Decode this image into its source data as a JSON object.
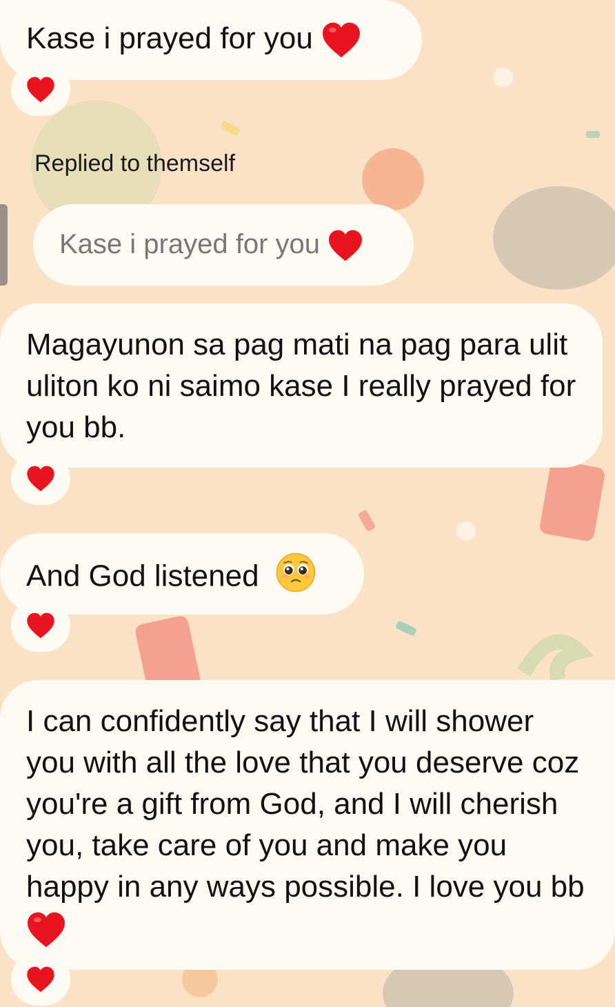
{
  "messages": [
    {
      "text": "Kase i prayed for you",
      "trailing": "heart-icon",
      "reaction": "heart-icon"
    },
    {
      "text": "Magayunon sa pag mati na pag para ulit uliton ko ni saimo kase I really prayed for you bb.",
      "reaction": "heart-icon"
    },
    {
      "text": "And God listened",
      "trailing": "pleading-face-icon",
      "reaction": "heart-icon"
    },
    {
      "text": "I can confidently say that I will shower you with all the love that you deserve coz you're a gift from God, and I will cherish you, take care of you and make you happy in any ways possible. I love you bb",
      "trailing": "heart-icon",
      "reaction": "heart-icon"
    }
  ],
  "reply": {
    "label": "Replied to themself",
    "quoted_text": "Kase i prayed for you",
    "quoted_trailing": "heart-icon"
  },
  "colors": {
    "background": "#fbe2c6",
    "bubble": "#fdfaf4",
    "heart": "#e8141f",
    "quoted_text": "#777777"
  }
}
